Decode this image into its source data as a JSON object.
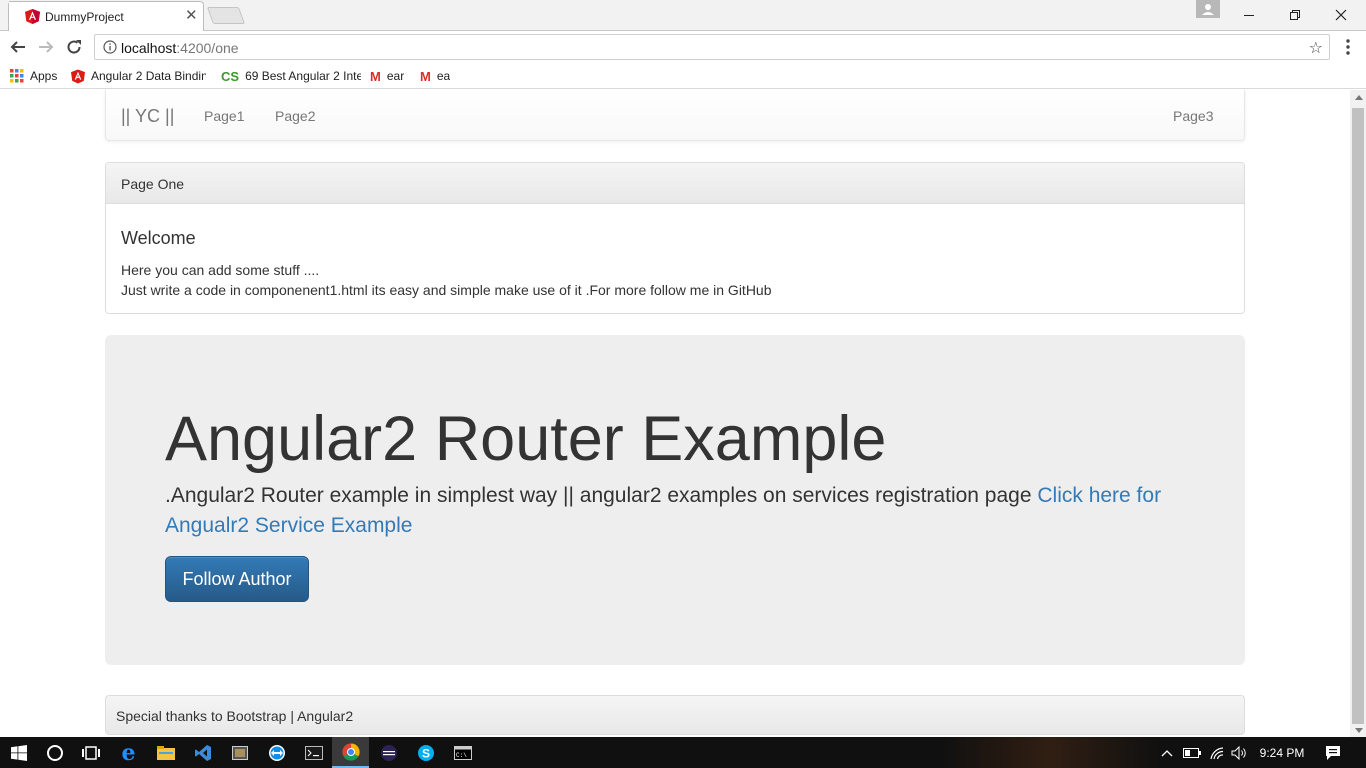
{
  "browser": {
    "tab_title": "DummyProject",
    "tab_close": "✕",
    "url_host": "localhost",
    "url_path": ":4200/one",
    "bookmarks": [
      {
        "label": "Apps",
        "icon": "apps-grid-icon"
      },
      {
        "label": "Angular 2 Data Bindin",
        "icon": "angular-icon"
      },
      {
        "label": "69 Best Angular 2 Inte",
        "icon": "cs-icon"
      },
      {
        "label": "ear",
        "icon": "gmail-icon"
      },
      {
        "label": "ea",
        "icon": "gmail-icon"
      }
    ]
  },
  "navbar": {
    "brand": "|| YC ||",
    "links": [
      "Page1",
      "Page2"
    ],
    "right_link": "Page3"
  },
  "panel": {
    "heading": "Page One",
    "title": "Welcome",
    "line1": "Here you can add some stuff ....",
    "line2": "Just write a code in componenent1.html its easy and simple make use of it .For more follow me in GitHub"
  },
  "jumbotron": {
    "title": "Angular2 Router Example",
    "lead": ".Angular2 Router example in simplest way || angular2 examples on services registration page ",
    "link": "Click here for Angualr2 Service Example",
    "button": "Follow Author"
  },
  "footer": {
    "text": "Special thanks to Bootstrap | Angular2"
  },
  "taskbar": {
    "time": "9:24 PM"
  },
  "colors": {
    "link": "#337ab7",
    "button": "#265a88",
    "jumbotron_bg": "#eeeeee",
    "angular_red": "#dd1b16",
    "taskbar": "#101010"
  }
}
